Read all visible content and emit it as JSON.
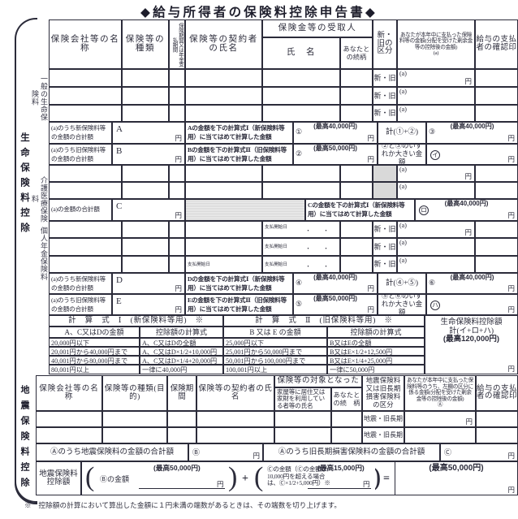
{
  "document": {
    "title": "◆給与所得者の保険料控除申告書◆",
    "footnote": "※　控除額の計算において算出した金額に１円未満の端数があるときは、その端数を切り上げます。"
  },
  "life_section": {
    "side_label": "生命保険料控除",
    "sub_labels": {
      "general": "一般の生命保険料",
      "care": "介護医療保険料",
      "pension": "個人年金保険料"
    },
    "headers": {
      "company": "保険会社等の名称",
      "kind": "保険等の種類",
      "period": "保険期間又は年金支払期間",
      "contractor": "保険等の契約者の氏名",
      "beneficiary_group": "保険金等の受取人",
      "beneficiary_name": "氏　名",
      "relation": "あなたとの続柄",
      "newold": "新・旧の区分",
      "paid_amount": "あなたが本年中に支払った保険料等の金額(分配を受けた剰余金等の控除後の金額)",
      "paid_amount_mark": "(a)",
      "confirm": "給与の支払者の確認印"
    },
    "newold_value": "新・旧",
    "cell_tag_a": "(a)",
    "yen": "円",
    "pension_start_label": "支払開始日",
    "pension_start_sep": "・",
    "general_rows": [
      {
        "left_label": "(a)のうち新保険料等の金額の合計額",
        "mark": "A",
        "formula": "Aの金額を下の計算式Ⅰ（新保険料等用）に当てはめて計算した金額",
        "num": "①",
        "max": "(最高40,000円)",
        "sum_label": "計(①+②)",
        "sum_num": "③",
        "sum_max": "(最高40,000円)"
      },
      {
        "left_label": "(a)のうち旧保険料等の金額の合計額",
        "mark": "B",
        "formula": "Bの金額を下の計算式Ⅱ（旧保険料等用）に当てはめて計算した金額",
        "num": "②",
        "max": "(最高50,000円)",
        "sum_label": "②と③のいずれか大きい金額",
        "sum_num": "イ",
        "sum_max": ""
      }
    ],
    "care_row": {
      "left_label": "(a)の金額の合計額",
      "mark": "C",
      "formula": "Cの金額を下の計算式Ⅰ（新保険料等用）に当てはめて計算した金額",
      "num": "ロ",
      "max": "(最高40,000円)"
    },
    "pension_rows": [
      {
        "left_label": "(a)のうち新保険料等の金額の合計額",
        "mark": "D",
        "formula": "Dの金額を下の計算式Ⅰ（新保険料等用）に当てはめて計算した金額",
        "num": "④",
        "max": "(最高40,000円)",
        "sum_label": "計(④+⑤)",
        "sum_num": "⑥",
        "sum_max": "(最高40,000円)"
      },
      {
        "left_label": "(a)のうち旧保険料等の金額の合計額",
        "mark": "E",
        "formula": "Eの金額を下の計算式Ⅱ（旧保険料等用）に当てはめて計算した金額",
        "num": "⑤",
        "max": "(最高50,000円)",
        "sum_label": "⑤と⑥のいずれか大きい金額",
        "sum_num": "ハ",
        "sum_max": ""
      }
    ]
  },
  "formula_tables": {
    "table1": {
      "title": "計　算　式　Ⅰ　(新保険料等用)　※",
      "col1": "A、C又はDの金額",
      "col2": "控除額の計算式",
      "rows": [
        {
          "range": "20,000円以下",
          "formula": "A、C又はDの全額"
        },
        {
          "range": "20,001円から40,000円まで",
          "formula": "A、C又はD×1/2+10,000円"
        },
        {
          "range": "40,001円から80,000円まで",
          "formula": "A、C又はD×1/4+20,000円"
        },
        {
          "range": "80,001円以上",
          "formula": "一律に40,000円"
        }
      ]
    },
    "table2": {
      "title": "計　算　式　Ⅱ　(旧保険料等用)　※",
      "col1": "B 又は E の金額",
      "col2": "控除額の計算式",
      "rows": [
        {
          "range": "25,000円以下",
          "formula": "B又はEの全額"
        },
        {
          "range": "25,001円から50,000円まで",
          "formula": "B又はE×1/2+12,500円"
        },
        {
          "range": "50,001円から100,000円まで",
          "formula": "B又はE×1/4+25,000円"
        },
        {
          "range": "100,001円以上",
          "formula": "一律に50,000円"
        }
      ]
    },
    "total_box": {
      "line1": "生命保険料控除額",
      "line2": "計(イ+ロ+ハ)",
      "line3": "(最高120,000円)",
      "yen": "円"
    }
  },
  "quake_section": {
    "side_label": "地震保険料控除",
    "headers": {
      "company": "保険会社等の名称",
      "kind": "保険等の種類(目的)",
      "period": "保険期間",
      "contractor": "保険等の契約者の氏名",
      "target_group": "保険等の対象となった",
      "resident": "家屋等に居住又は家財を利用している者等の氏名",
      "relation": "あなたとの続　柄",
      "category": "地震保険料又は旧長期損害保険料の区分",
      "paid_amount": "あなたが本年中に支払った保険料等のうち、左欄の区分に係る金額(分配を受けた剰余金等の控除後の金額)",
      "paid_amount_mark": "Ⓐ",
      "confirm": "給与の支払者の確認印"
    },
    "category_value": "地震・旧長期",
    "yen": "円",
    "subtotal_b": {
      "label": "Ⓐのうち地震保険料の金額の合計額",
      "mark": "Ⓑ",
      "yen": "円"
    },
    "subtotal_c": {
      "label": "Ⓐのうち旧長期損害保険料の金額の合計額",
      "mark": "Ⓒ",
      "yen": "円"
    },
    "deduction": {
      "label": "地震保険料控除額",
      "term1_label": "Ⓑの金額",
      "term1_max": "(最高50,000円)",
      "term1_yen": "円",
      "plus": "+",
      "term2_label": "Ⓒの金額（Ⓒの金額が10,000円を超える場合は、Ⓒ×1/2+5,000円）※",
      "term2_max": "(最高15,000円)",
      "term2_yen": "円",
      "equals": "=",
      "result_max": "(最高50,000円)",
      "result_yen": "円"
    }
  }
}
